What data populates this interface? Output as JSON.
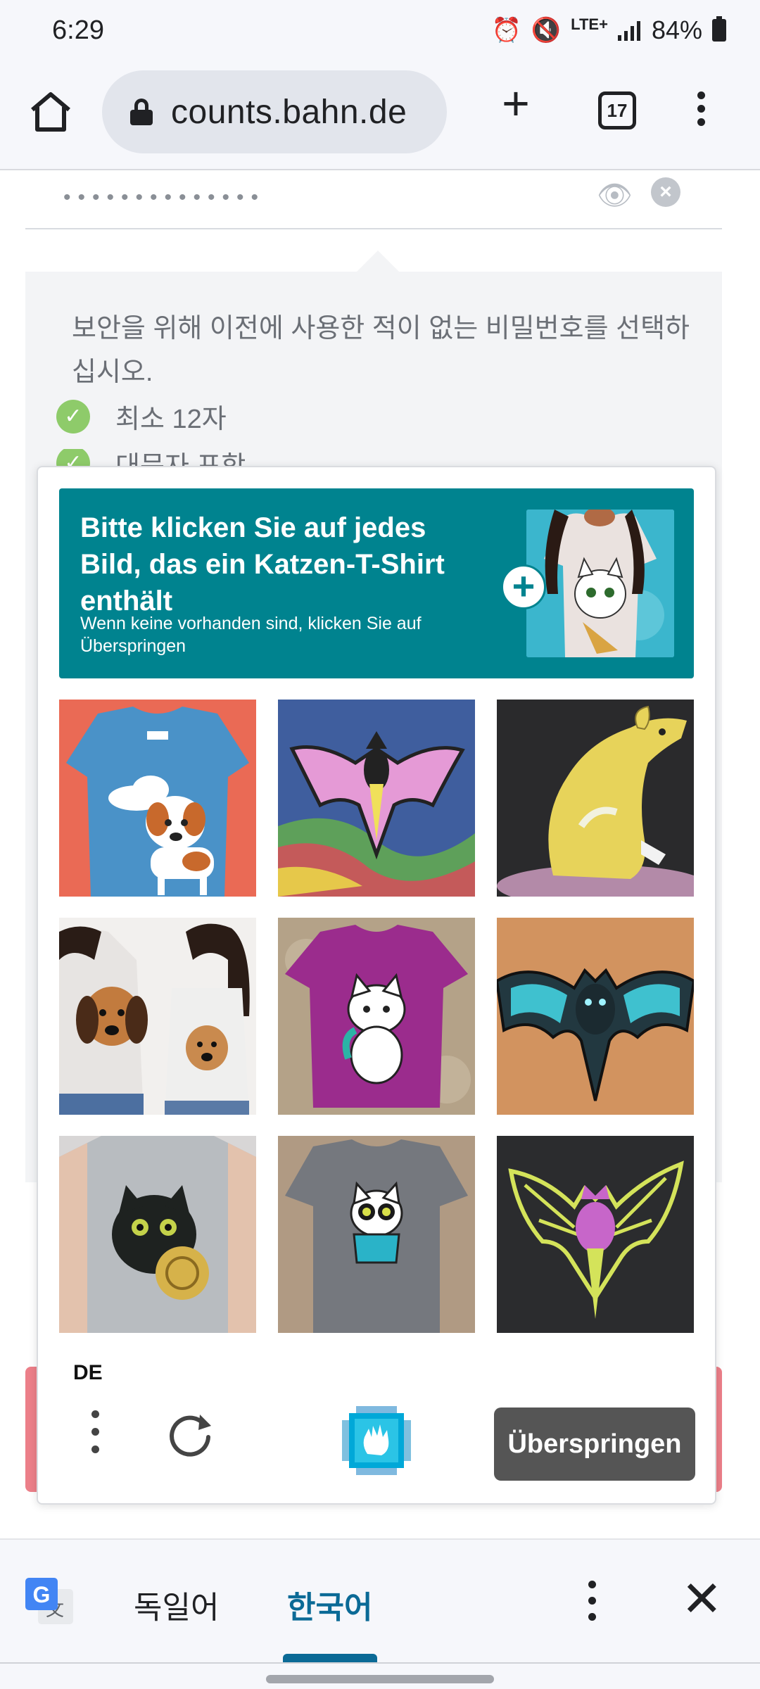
{
  "status_bar": {
    "time": "6:29",
    "network": "LTE+",
    "battery": "84%",
    "icons": [
      "alarm-icon",
      "mute-icon",
      "signal-icon",
      "battery-icon"
    ]
  },
  "browser": {
    "url": "counts.bahn.de",
    "tab_count": "17",
    "icons": [
      "home-icon",
      "lock-icon",
      "new-tab-icon",
      "tabs-icon",
      "more-icon"
    ]
  },
  "page": {
    "password_mask": "••••••••••••••",
    "hint_text": "보안을 위해 이전에 사용한 적이 없는 비밀번호를 선택하십시오.",
    "requirements": [
      "최소 12자",
      "대문자 포함"
    ]
  },
  "captcha": {
    "title": "Bitte klicken Sie auf jedes Bild, das ein Katzen-T-Shirt enthält",
    "subtitle": "Wenn keine vorhanden sind, klicken Sie auf Überspringen",
    "language": "DE",
    "skip_label": "Überspringen",
    "tiles": [
      {
        "subject": "dog-tshirt"
      },
      {
        "subject": "bat-drawing"
      },
      {
        "subject": "rat-drawing"
      },
      {
        "subject": "dog-tshirts-people"
      },
      {
        "subject": "cat-tshirt-purple"
      },
      {
        "subject": "bat-drawing-teal"
      },
      {
        "subject": "cat-tshirt-woman"
      },
      {
        "subject": "cat-tshirt-gray"
      },
      {
        "subject": "bat-drawing-purple"
      }
    ],
    "colors": {
      "header": "#00838f",
      "skip_button": "#555555"
    }
  },
  "translate_bar": {
    "source_lang": "독일어",
    "target_lang": "한국어",
    "accent": "#0b6a96"
  }
}
